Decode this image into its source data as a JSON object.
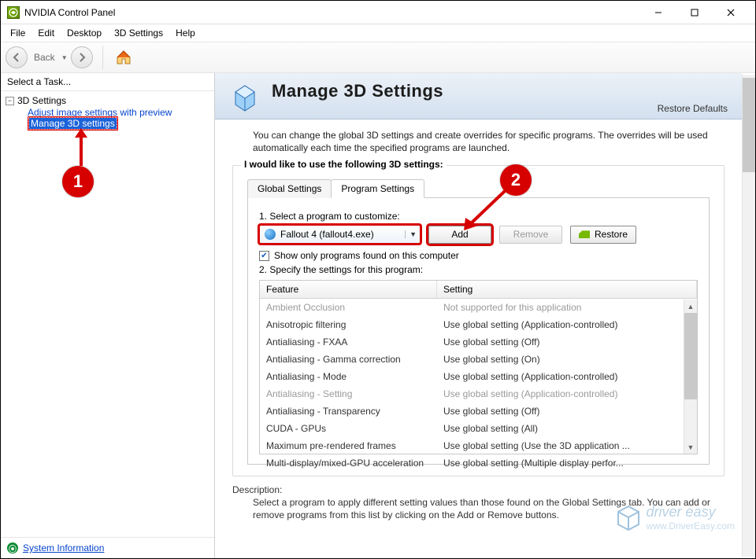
{
  "window": {
    "title": "NVIDIA Control Panel"
  },
  "menu": {
    "file": "File",
    "edit": "Edit",
    "desktop": "Desktop",
    "settings3d": "3D Settings",
    "help": "Help"
  },
  "toolbar": {
    "back": "Back"
  },
  "sidebar": {
    "select_task": "Select a Task...",
    "root": "3D Settings",
    "items": [
      {
        "label": "Adjust image settings with preview"
      },
      {
        "label": "Manage 3D settings"
      }
    ],
    "sysinfo": "System Information"
  },
  "page": {
    "title": "Manage 3D Settings",
    "restore": "Restore Defaults",
    "intro": "You can change the global 3D settings and create overrides for specific programs. The overrides will be used automatically each time the specified programs are launched.",
    "group_title": "I would like to use the following 3D settings:",
    "tabs": {
      "global": "Global Settings",
      "program": "Program Settings"
    },
    "step1": "1. Select a program to customize:",
    "combo_value": "Fallout 4 (fallout4.exe)",
    "btn_add": "Add",
    "btn_remove": "Remove",
    "btn_restore": "Restore",
    "chk_label": "Show only programs found on this computer",
    "step2": "2. Specify the settings for this program:",
    "th_feature": "Feature",
    "th_setting": "Setting",
    "rows": [
      {
        "f": "Ambient Occlusion",
        "s": "Not supported for this application",
        "dim": true
      },
      {
        "f": "Anisotropic filtering",
        "s": "Use global setting (Application-controlled)"
      },
      {
        "f": "Antialiasing - FXAA",
        "s": "Use global setting (Off)"
      },
      {
        "f": "Antialiasing - Gamma correction",
        "s": "Use global setting (On)"
      },
      {
        "f": "Antialiasing - Mode",
        "s": "Use global setting (Application-controlled)"
      },
      {
        "f": "Antialiasing - Setting",
        "s": "Use global setting (Application-controlled)",
        "dim": true
      },
      {
        "f": "Antialiasing - Transparency",
        "s": "Use global setting (Off)"
      },
      {
        "f": "CUDA - GPUs",
        "s": "Use global setting (All)"
      },
      {
        "f": "Maximum pre-rendered frames",
        "s": "Use global setting (Use the 3D application ..."
      },
      {
        "f": "Multi-display/mixed-GPU acceleration",
        "s": "Use global setting (Multiple display perfor..."
      }
    ],
    "desc_label": "Description:",
    "desc_text": "Select a program to apply different setting values than those found on the Global Settings tab. You can add or remove programs from this list by clicking on the Add or Remove buttons."
  },
  "annotations": {
    "one": "1",
    "two": "2"
  },
  "watermark": {
    "brand": "driver easy",
    "url": "www.DriverEasy.com"
  }
}
